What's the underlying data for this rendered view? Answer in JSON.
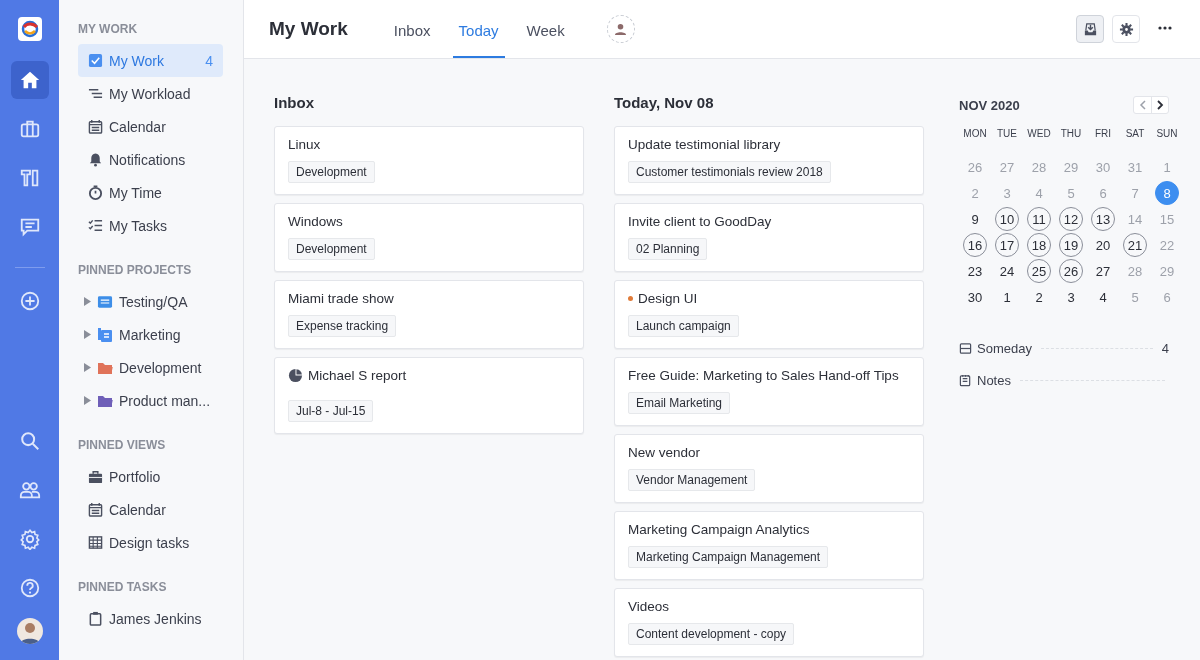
{
  "rail": {
    "items": [
      {
        "selected": true
      },
      {
        "selected": false
      },
      {
        "selected": false
      },
      {
        "selected": false
      },
      {
        "selected": false
      }
    ],
    "bottom_items": [
      {
        "selected": false
      },
      {
        "selected": false
      },
      {
        "selected": false
      },
      {
        "selected": false
      }
    ]
  },
  "sidebar": {
    "sections": [
      {
        "title": "MY WORK",
        "items": [
          {
            "label": "My Work",
            "count": "4",
            "selected": true
          },
          {
            "label": "My Workload",
            "selected": false
          },
          {
            "label": "Calendar",
            "selected": false
          },
          {
            "label": "Notifications",
            "selected": false
          },
          {
            "label": "My Time",
            "selected": false
          },
          {
            "label": "My Tasks",
            "selected": false
          }
        ]
      },
      {
        "title": "PINNED PROJECTS",
        "kind": "projects",
        "items": [
          {
            "label": "Testing/QA",
            "color": "#3d8ee8",
            "selected": false
          },
          {
            "label": "Marketing",
            "color": "#4a8ff0",
            "selected": false
          },
          {
            "label": "Development",
            "color": "#e0735a",
            "selected": false
          },
          {
            "label": "Product man...",
            "color": "#6f5fb8",
            "selected": false
          }
        ]
      },
      {
        "title": "PINNED VIEWS",
        "items": [
          {
            "label": "Portfolio",
            "selected": false
          },
          {
            "label": "Calendar",
            "selected": false
          },
          {
            "label": "Design tasks",
            "selected": false
          }
        ]
      },
      {
        "title": "PINNED TASKS",
        "items": [
          {
            "label": "James Jenkins",
            "selected": false
          }
        ]
      }
    ]
  },
  "header": {
    "title": "My Work",
    "tabs": [
      {
        "label": "Inbox",
        "selected": false
      },
      {
        "label": "Today",
        "selected": true
      },
      {
        "label": "Week",
        "selected": false
      }
    ],
    "toolbar": [
      {
        "pressed": true
      },
      {
        "pressed": false
      }
    ]
  },
  "inbox": {
    "title": "Inbox",
    "cards": [
      {
        "title": "Linux",
        "tag": "Development",
        "kind": "plain"
      },
      {
        "title": "Windows",
        "tag": "Development",
        "kind": "plain"
      },
      {
        "title": "Miami trade show",
        "tag": "Expense tracking",
        "kind": "plain"
      },
      {
        "title": "Michael S report",
        "tag": "Jul-8 - Jul-15",
        "kind": "report"
      }
    ]
  },
  "today": {
    "title": "Today, Nov 08",
    "cards": [
      {
        "title": "Update testimonial library",
        "tag": "Customer testimonials review 2018",
        "kind": "plain"
      },
      {
        "title": "Invite client to GoodDay",
        "tag": "02 Planning",
        "kind": "plain"
      },
      {
        "title": "Design UI",
        "tag": "Launch campaign",
        "kind": "dot",
        "color": "#e07b39"
      },
      {
        "title": "Free Guide: Marketing to Sales Hand-off Tips",
        "tag": "Email Marketing",
        "kind": "plain"
      },
      {
        "title": "New vendor",
        "tag": "Vendor Management",
        "kind": "plain"
      },
      {
        "title": "Marketing Campaign Analytics",
        "tag": "Marketing Campaign Management",
        "kind": "plain"
      },
      {
        "title": "Videos",
        "tag": "Content development - copy",
        "kind": "plain"
      }
    ]
  },
  "calendar": {
    "title": "NOV 2020",
    "weekdays": [
      "MON",
      "TUE",
      "WED",
      "THU",
      "FRI",
      "SAT",
      "SUN"
    ],
    "weeks": [
      {
        "days": [
          {
            "label": "26",
            "muted": true,
            "marked": false,
            "selected": false
          },
          {
            "label": "27",
            "muted": true,
            "marked": false,
            "selected": false
          },
          {
            "label": "28",
            "muted": true,
            "marked": false,
            "selected": false
          },
          {
            "label": "29",
            "muted": true,
            "marked": false,
            "selected": false
          },
          {
            "label": "30",
            "muted": true,
            "marked": false,
            "selected": false
          },
          {
            "label": "31",
            "muted": true,
            "marked": false,
            "selected": false
          },
          {
            "label": "1",
            "muted": true,
            "marked": false,
            "selected": false
          }
        ]
      },
      {
        "days": [
          {
            "label": "2",
            "muted": true,
            "marked": false,
            "selected": false
          },
          {
            "label": "3",
            "muted": true,
            "marked": false,
            "selected": false
          },
          {
            "label": "4",
            "muted": true,
            "marked": false,
            "selected": false
          },
          {
            "label": "5",
            "muted": true,
            "marked": false,
            "selected": false
          },
          {
            "label": "6",
            "muted": true,
            "marked": false,
            "selected": false
          },
          {
            "label": "7",
            "muted": true,
            "marked": false,
            "selected": false
          },
          {
            "label": "8",
            "muted": false,
            "marked": false,
            "selected": true
          }
        ]
      },
      {
        "days": [
          {
            "label": "9",
            "muted": false,
            "marked": false,
            "selected": false
          },
          {
            "label": "10",
            "muted": false,
            "marked": true,
            "selected": false
          },
          {
            "label": "11",
            "muted": false,
            "marked": true,
            "selected": false
          },
          {
            "label": "12",
            "muted": false,
            "marked": true,
            "selected": false
          },
          {
            "label": "13",
            "muted": false,
            "marked": true,
            "selected": false
          },
          {
            "label": "14",
            "muted": true,
            "marked": false,
            "selected": false
          },
          {
            "label": "15",
            "muted": true,
            "marked": false,
            "selected": false
          }
        ]
      },
      {
        "days": [
          {
            "label": "16",
            "muted": false,
            "marked": true,
            "selected": false
          },
          {
            "label": "17",
            "muted": false,
            "marked": true,
            "selected": false
          },
          {
            "label": "18",
            "muted": false,
            "marked": true,
            "selected": false
          },
          {
            "label": "19",
            "muted": false,
            "marked": true,
            "selected": false
          },
          {
            "label": "20",
            "muted": false,
            "marked": false,
            "selected": false
          },
          {
            "label": "21",
            "muted": false,
            "marked": true,
            "selected": false
          },
          {
            "label": "22",
            "muted": true,
            "marked": false,
            "selected": false
          }
        ]
      },
      {
        "days": [
          {
            "label": "23",
            "muted": false,
            "marked": false,
            "selected": false
          },
          {
            "label": "24",
            "muted": false,
            "marked": false,
            "selected": false
          },
          {
            "label": "25",
            "muted": false,
            "marked": true,
            "selected": false
          },
          {
            "label": "26",
            "muted": false,
            "marked": true,
            "selected": false
          },
          {
            "label": "27",
            "muted": false,
            "marked": false,
            "selected": false
          },
          {
            "label": "28",
            "muted": true,
            "marked": false,
            "selected": false
          },
          {
            "label": "29",
            "muted": true,
            "marked": false,
            "selected": false
          }
        ]
      },
      {
        "days": [
          {
            "label": "30",
            "muted": false,
            "marked": false,
            "selected": false
          },
          {
            "label": "1",
            "muted": false,
            "marked": false,
            "selected": false
          },
          {
            "label": "2",
            "muted": false,
            "marked": false,
            "selected": false
          },
          {
            "label": "3",
            "muted": false,
            "marked": false,
            "selected": false
          },
          {
            "label": "4",
            "muted": false,
            "marked": false,
            "selected": false
          },
          {
            "label": "5",
            "muted": true,
            "marked": false,
            "selected": false
          },
          {
            "label": "6",
            "muted": true,
            "marked": false,
            "selected": false
          }
        ]
      }
    ],
    "lists": [
      {
        "label": "Someday",
        "count": "4"
      },
      {
        "label": "Notes"
      }
    ]
  }
}
